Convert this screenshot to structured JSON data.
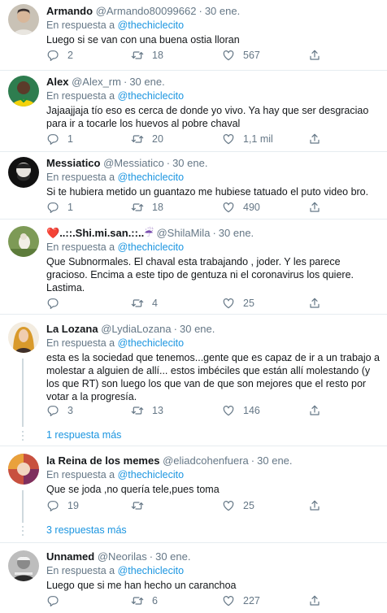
{
  "tweets": [
    {
      "name": "Armando",
      "handle": "@Armando80099662",
      "date": "30 ene.",
      "reply_prefix": "En respuesta a",
      "reply_to": "@thechiclecito",
      "text": "Luego si se van con una buena ostia lloran",
      "replies": "2",
      "retweets": "18",
      "likes": "567"
    },
    {
      "name": "Alex",
      "handle": "@Alex_rm",
      "date": "30 ene.",
      "reply_prefix": "En respuesta a",
      "reply_to": "@thechiclecito",
      "text": "Jajaajjaja tío eso es cerca de donde yo vivo. Ya hay que ser desgraciao para ir a tocarle los huevos al pobre chaval",
      "replies": "1",
      "retweets": "20",
      "likes": "1,1 mil"
    },
    {
      "name": "Messiatico",
      "handle": "@Messiatico",
      "date": "30 ene.",
      "reply_prefix": "En respuesta a",
      "reply_to": "@thechiclecito",
      "text": "Si te hubiera metido un guantazo me hubiese tatuado el puto video bro.",
      "replies": "1",
      "retweets": "18",
      "likes": "490"
    },
    {
      "name_heart": "❤️",
      "name": "..::.Shi.mi.san.::..",
      "name_umbrella": "☔",
      "handle": "@ShilaMila",
      "date": "30 ene.",
      "reply_prefix": "En respuesta a",
      "reply_to": "@thechiclecito",
      "text": "Que Subnormales. El chaval esta trabajando , joder. Y les parece gracioso. Encima a este tipo de gentuza ni el coronavirus los quiere. Lastima.",
      "replies": "",
      "retweets": "4",
      "likes": "25"
    },
    {
      "name": "La Lozana",
      "handle": "@LydiaLozana",
      "date": "30 ene.",
      "reply_prefix": "En respuesta a",
      "reply_to": "@thechiclecito",
      "text": "esta es la sociedad que tenemos...gente que es capaz de ir a un trabajo a molestar a alguien de allí... estos imbéciles que están allí molestando (y los que RT) son luego los que van de que son mejores que el resto por votar a la progresía.",
      "replies": "3",
      "retweets": "13",
      "likes": "146",
      "more_replies": "1 respuesta más"
    },
    {
      "name": "la Reina de los memes",
      "handle": "@eliadcohenfuera",
      "date": "30 ene.",
      "reply_prefix": "En respuesta a",
      "reply_to": "@thechiclecito",
      "text": "Que se joda ,no quería tele,pues toma",
      "replies": "19",
      "retweets": "",
      "likes": "25",
      "more_replies": "3 respuestas más"
    },
    {
      "name": "Unnamed",
      "handle": "@Neorilas",
      "date": "30 ene.",
      "reply_prefix": "En respuesta a",
      "reply_to": "@thechiclecito",
      "text": "Luego que si me han hecho un carancho​a",
      "replies": "",
      "retweets": "6",
      "likes": "227"
    }
  ],
  "icons": {
    "reply": "reply-icon",
    "retweet": "retweet-icon",
    "like": "heart-icon",
    "share": "share-icon"
  },
  "colors": {
    "text": "#14171a",
    "muted": "#657786",
    "link": "#1b95e0",
    "divider": "#e6ecf0"
  }
}
